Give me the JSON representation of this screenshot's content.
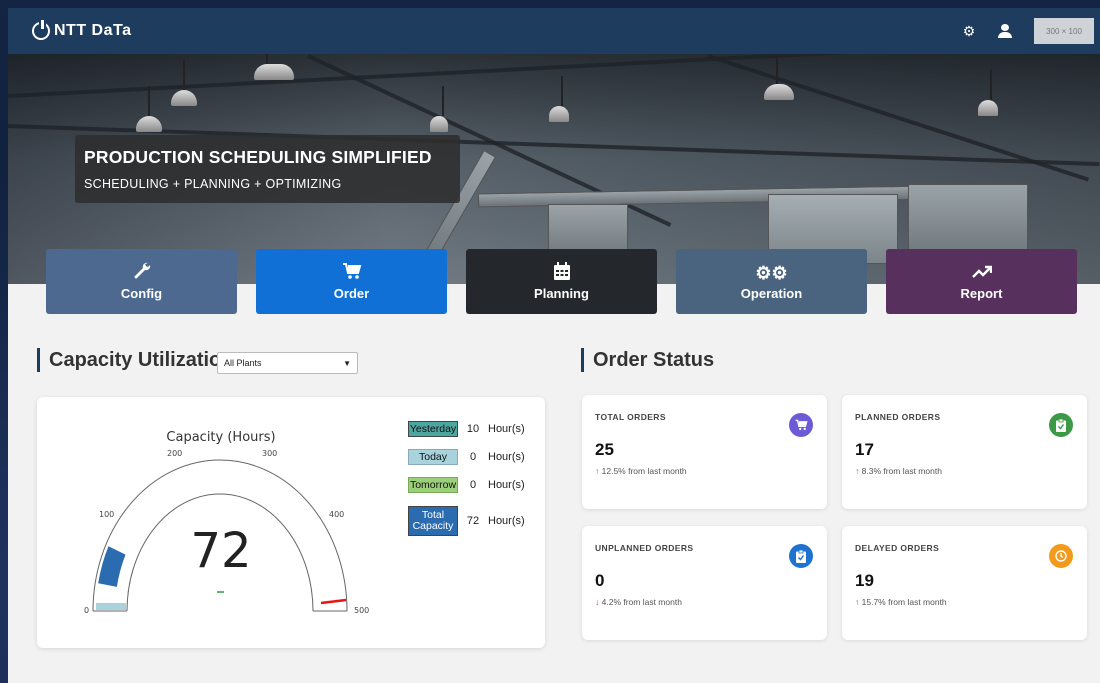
{
  "header": {
    "logo_text": "NTT DaTa",
    "settings_icon": "gear-icon",
    "user_icon": "user-icon",
    "placeholder_label": "300 × 100"
  },
  "hero": {
    "title": "PRODUCTION SCHEDULING SIMPLIFIED",
    "subtitle": "SCHEDULING + PLANNING + OPTIMIZING"
  },
  "tiles": [
    {
      "label": "Config",
      "icon": "wrench-icon",
      "color": "#4d6990"
    },
    {
      "label": "Order",
      "icon": "cart-icon",
      "color": "#1170d6"
    },
    {
      "label": "Planning",
      "icon": "calendar-icon",
      "color": "#24272c"
    },
    {
      "label": "Operation",
      "icon": "gears-icon",
      "color": "#4a6480"
    },
    {
      "label": "Report",
      "icon": "trend-icon",
      "color": "#57305e"
    }
  ],
  "capacity": {
    "section_title": "Capacity Utilization",
    "plant_select": {
      "selected": "All Plants"
    },
    "gauge": {
      "title": "Capacity (Hours)",
      "value": "72",
      "min": 0,
      "max": 500,
      "ticks": [
        "0",
        "100",
        "200",
        "300",
        "400",
        "500"
      ],
      "needle_value": 72
    },
    "legend": [
      {
        "label": "Yesterday",
        "value": "10",
        "unit": "Hour(s)",
        "color": "#4ea6a0"
      },
      {
        "label": "Today",
        "value": "0",
        "unit": "Hour(s)",
        "color": "#a8d3dc"
      },
      {
        "label": "Tomorrow",
        "value": "0",
        "unit": "Hour(s)",
        "color": "#9bcf7a"
      },
      {
        "label": "Total Capacity",
        "value": "72",
        "unit": "Hour(s)",
        "color": "#2b6cb0"
      }
    ]
  },
  "orders": {
    "section_title": "Order Status",
    "cards": [
      {
        "label": "TOTAL ORDERS",
        "value": "25",
        "delta": "12.5% from last month",
        "direction": "up",
        "icon": "cart-icon",
        "icon_color": "#6b5bd6"
      },
      {
        "label": "PLANNED ORDERS",
        "value": "17",
        "delta": "8.3% from last month",
        "direction": "up",
        "icon": "clipboard-check-icon",
        "icon_color": "#3c9a46"
      },
      {
        "label": "UNPLANNED ORDERS",
        "value": "0",
        "delta": "4.2% from last month",
        "direction": "down",
        "icon": "clipboard-icon",
        "icon_color": "#1e73d0"
      },
      {
        "label": "DELAYED ORDERS",
        "value": "19",
        "delta": "15.7% from last month",
        "direction": "up",
        "icon": "clock-icon",
        "icon_color": "#f39a1c"
      }
    ]
  }
}
